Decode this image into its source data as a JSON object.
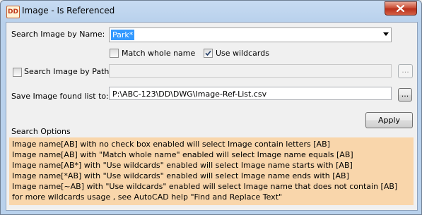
{
  "window": {
    "title": "Image - Is Referenced",
    "icon": "autocad-app-icon",
    "icon_text": "DD",
    "close_icon": "close-x-icon"
  },
  "search_name": {
    "label": "Search Image by Name:",
    "value": "Park*",
    "dropdown_icon": "chevron-down-icon"
  },
  "options": {
    "match_whole_name": {
      "label": "Match whole name",
      "checked": false
    },
    "use_wildcards": {
      "label": "Use wildcards",
      "checked": true
    }
  },
  "search_path": {
    "label": "Search Image by Path",
    "checked": false,
    "value": "",
    "browse_label": "..."
  },
  "save_list": {
    "label": "Save Image found list to:",
    "value": "P:\\ABC-123\\DD\\DWG\\Image-Ref-List.csv",
    "browse_label": "..."
  },
  "apply_label": "Apply",
  "search_options": {
    "heading": "Search Options",
    "lines": [
      "Image name[AB] with no check box enabled will select Image contain letters [AB]",
      "Image name[AB] with \"Match whole name\" enabled will select Image name equals [AB]",
      "Image name[AB*] with \"Use wildcards\" enabled will select Image name starts with [AB]",
      "Image name[*AB] with \"Use wildcards\" enabled will select Image name ends with [AB]",
      "Image name[~AB] with \"Use wildcards\" enabled will select Image name that does not contain [AB]",
      "for more wildcards usage , see AutoCAD help  \"Find and Replace Text\""
    ],
    "background": "#f9d6ab"
  },
  "colors": {
    "titlebar": "#b9d1ec",
    "close_button": "#c7452d",
    "selection": "#3399ff"
  }
}
